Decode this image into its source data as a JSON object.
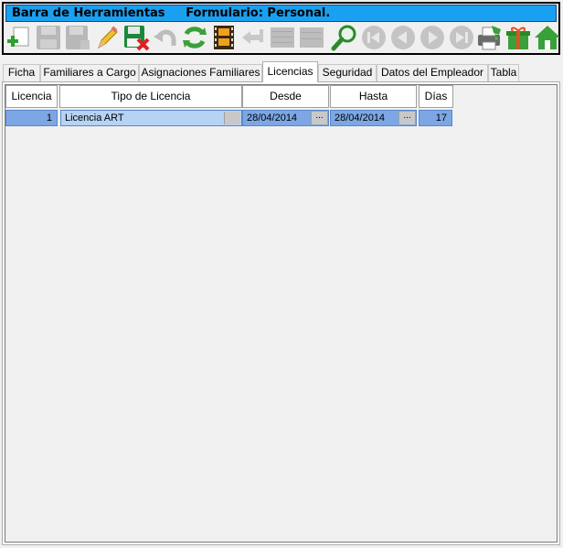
{
  "toolbar": {
    "title": "Barra de Herramientas",
    "form_label": "Formulario: Personal.",
    "buttons": [
      {
        "name": "new-record",
        "icon": "plus-document-icon",
        "enabled": true
      },
      {
        "name": "save",
        "icon": "floppy-icon",
        "enabled": false
      },
      {
        "name": "save-as",
        "icon": "floppy-edit-icon",
        "enabled": false
      },
      {
        "name": "edit",
        "icon": "pencil-icon",
        "enabled": true
      },
      {
        "name": "delete",
        "icon": "floppy-delete-icon",
        "enabled": true
      },
      {
        "name": "undo",
        "icon": "undo-icon",
        "enabled": false
      },
      {
        "name": "refresh",
        "icon": "refresh-icon",
        "enabled": true
      },
      {
        "name": "film",
        "icon": "film-icon",
        "enabled": true
      },
      {
        "name": "back",
        "icon": "arrow-back-icon",
        "enabled": false
      },
      {
        "name": "grid-a",
        "icon": "grid-icon",
        "enabled": false
      },
      {
        "name": "grid-b",
        "icon": "grid-icon",
        "enabled": false
      },
      {
        "name": "search",
        "icon": "magnifier-icon",
        "enabled": true
      },
      {
        "name": "first",
        "icon": "first-icon",
        "enabled": false
      },
      {
        "name": "prev",
        "icon": "prev-icon",
        "enabled": false
      },
      {
        "name": "next",
        "icon": "next-icon",
        "enabled": false
      },
      {
        "name": "last",
        "icon": "last-icon",
        "enabled": false
      },
      {
        "name": "print",
        "icon": "printer-icon",
        "enabled": true
      },
      {
        "name": "gift",
        "icon": "gift-icon",
        "enabled": true
      },
      {
        "name": "home",
        "icon": "home-icon",
        "enabled": true
      }
    ]
  },
  "tabs": [
    "Ficha",
    "Familiares a Cargo",
    "Asignaciones Familiares",
    "Licencias",
    "Seguridad",
    "Datos del Empleador",
    "Tabla"
  ],
  "active_tab": "Licencias",
  "grid": {
    "columns": [
      "Licencia",
      "Tipo de Licencia",
      "Desde",
      "Hasta",
      "Días"
    ],
    "rows": [
      {
        "licencia": "1",
        "tipo": "Licencia ART",
        "desde": "28/04/2014",
        "hasta": "28/04/2014",
        "dias": "17"
      }
    ],
    "ellipsis": "..."
  },
  "colors": {
    "title_bar": "#1aa0f0",
    "selected_row": "#7ca7e4",
    "selected_cell": "#b5d3f3"
  }
}
